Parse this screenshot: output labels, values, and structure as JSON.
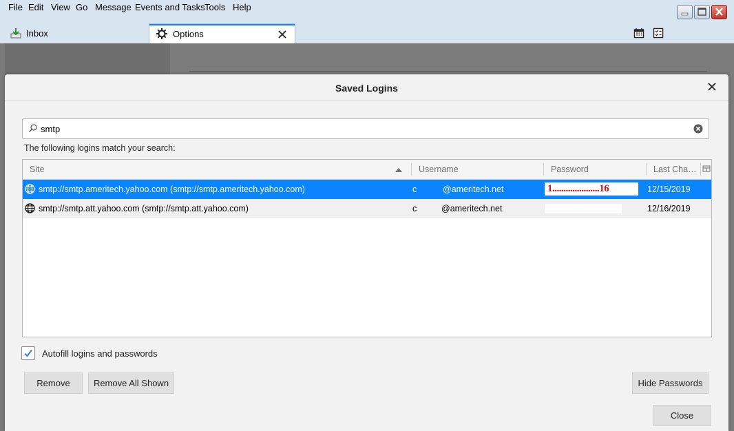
{
  "menubar": {
    "items": [
      "File",
      "Edit",
      "View",
      "Go",
      "Message",
      "Events and Tasks",
      "Tools",
      "Help"
    ]
  },
  "tabs": [
    {
      "label": "Inbox",
      "icon": "inbox-download-icon"
    },
    {
      "label": "Options",
      "icon": "gear-icon"
    }
  ],
  "dialog": {
    "title": "Saved Logins",
    "search": {
      "value": "smtp"
    },
    "match_text": "The following logins match your search:",
    "columns": [
      "Site",
      "Username",
      "Password",
      "Last Cha…"
    ],
    "rows": [
      {
        "site": "smtp://smtp.ameritech.yahoo.com (smtp://smtp.ameritech.yahoo.com)",
        "username_prefix": "c",
        "username_domain": "@ameritech.net",
        "password": "1.....................16",
        "last_changed": "12/15/2019"
      },
      {
        "site": "smtp://smtp.att.yahoo.com (smtp://smtp.att.yahoo.com)",
        "username_prefix": "c",
        "username_domain": "@ameritech.net",
        "password": "",
        "last_changed": "12/16/2019"
      }
    ],
    "autofill": {
      "label": "Autofill logins and passwords",
      "checked": true
    },
    "buttons": {
      "remove": "Remove",
      "remove_all": "Remove All Shown",
      "hide_passwords": "Hide Passwords",
      "close": "Close"
    }
  },
  "colors": {
    "selection": "#0a84ff",
    "password_mark": "#d01010"
  }
}
